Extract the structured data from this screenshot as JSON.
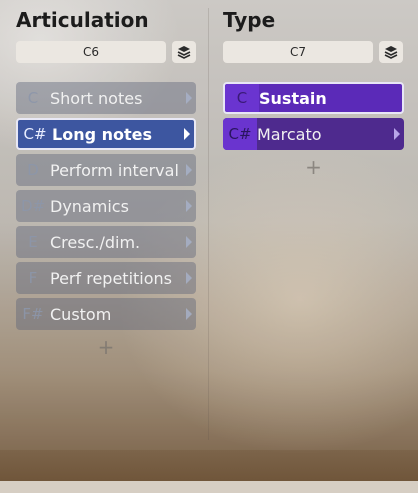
{
  "articulation": {
    "title": "Articulation",
    "key": "C6",
    "add_label": "+",
    "items": [
      {
        "key": "C",
        "label": "Short notes"
      },
      {
        "key": "C#",
        "label": "Long notes"
      },
      {
        "key": "D",
        "label": "Perform interval"
      },
      {
        "key": "D#",
        "label": "Dynamics"
      },
      {
        "key": "E",
        "label": "Cresc./dim."
      },
      {
        "key": "F",
        "label": "Perf repetitions"
      },
      {
        "key": "F#",
        "label": "Custom"
      }
    ]
  },
  "type": {
    "title": "Type",
    "key": "C7",
    "add_label": "+",
    "items": [
      {
        "key": "C",
        "label": "Sustain"
      },
      {
        "key": "C#",
        "label": "Marcato"
      }
    ]
  },
  "icons": {
    "layers": "layers-icon",
    "arrow": "chevron-right-icon",
    "add": "plus-icon"
  },
  "colors": {
    "selected_blue": "#3d56a0",
    "selected_purple": "#5b2ab8",
    "purple": "#4e2a8e"
  }
}
